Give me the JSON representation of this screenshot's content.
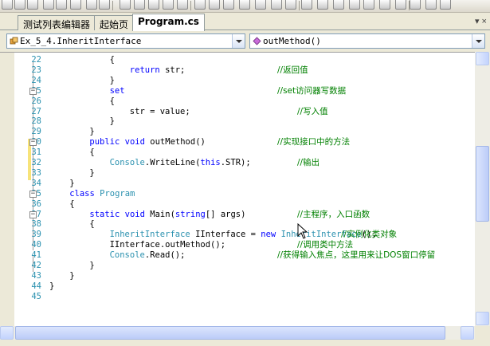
{
  "tabs": [
    {
      "label": "测试列表编辑器",
      "active": false
    },
    {
      "label": "起始页",
      "active": false
    },
    {
      "label": "Program.cs",
      "active": true
    }
  ],
  "tab_close": "▾ ×",
  "nav": {
    "class_combo": "Ex_5_4.InheritInterface",
    "member_combo": "outMethod()"
  },
  "code_lines": [
    {
      "n": "22",
      "indent": 12,
      "text": "{",
      "comment": "",
      "ccol": 0
    },
    {
      "n": "23",
      "indent": 16,
      "text": "return str;",
      "comment": "//返回值",
      "ccol": 330
    },
    {
      "n": "24",
      "indent": 12,
      "text": "}",
      "comment": "",
      "ccol": 0
    },
    {
      "n": "25",
      "indent": 12,
      "text": "set",
      "comment": "//set访问器写数据",
      "ccol": 330
    },
    {
      "n": "26",
      "indent": 12,
      "text": "{",
      "comment": "",
      "ccol": 0
    },
    {
      "n": "27",
      "indent": 16,
      "text": "str = value;",
      "comment": "//写入值",
      "ccol": 355
    },
    {
      "n": "28",
      "indent": 12,
      "text": "}",
      "comment": "",
      "ccol": 0
    },
    {
      "n": "29",
      "indent": 8,
      "text": "}",
      "comment": "",
      "ccol": 0
    },
    {
      "n": "30",
      "indent": 8,
      "text": "public void outMethod()",
      "comment": "//实现接口中的方法",
      "ccol": 330
    },
    {
      "n": "31",
      "indent": 8,
      "text": "{",
      "comment": "",
      "ccol": 0
    },
    {
      "n": "32",
      "indent": 12,
      "text": "Console.WriteLine(this.STR);",
      "comment": "//输出",
      "ccol": 355
    },
    {
      "n": "33",
      "indent": 8,
      "text": "}",
      "comment": "",
      "ccol": 0
    },
    {
      "n": "34",
      "indent": 4,
      "text": "}",
      "comment": "",
      "ccol": 0
    },
    {
      "n": "35",
      "indent": 4,
      "text": "class Program",
      "comment": "",
      "ccol": 0
    },
    {
      "n": "36",
      "indent": 4,
      "text": "{",
      "comment": "",
      "ccol": 0
    },
    {
      "n": "37",
      "indent": 8,
      "text": "static void Main(string[] args)",
      "comment": "//主程序，入口函数",
      "ccol": 355
    },
    {
      "n": "38",
      "indent": 8,
      "text": "{",
      "comment": "",
      "ccol": 0
    },
    {
      "n": "39",
      "indent": 12,
      "text": "InheritInterface IInterface = new InheritInterface();",
      "comment": "//实例化类对象",
      "ccol": 410
    },
    {
      "n": "40",
      "indent": 12,
      "text": "IInterface.outMethod();",
      "comment": "//调用类中方法",
      "ccol": 355
    },
    {
      "n": "41",
      "indent": 12,
      "text": "Console.Read();",
      "comment": "//获得输入焦点，这里用来让DOS窗口停留",
      "ccol": 330
    },
    {
      "n": "42",
      "indent": 8,
      "text": "}",
      "comment": "",
      "ccol": 0
    },
    {
      "n": "43",
      "indent": 4,
      "text": "}",
      "comment": "",
      "ccol": 0
    },
    {
      "n": "44",
      "indent": 0,
      "text": "}",
      "comment": "",
      "ccol": 0
    },
    {
      "n": "45",
      "indent": 0,
      "text": "",
      "comment": "",
      "ccol": 0
    }
  ],
  "colors": {
    "keyword": "#0000ff",
    "type": "#2b91af",
    "comment": "#008000",
    "line_number": "#2b91af"
  },
  "icons": {
    "class_combo_icon": "class-icon",
    "member_combo_icon": "method-icon"
  }
}
